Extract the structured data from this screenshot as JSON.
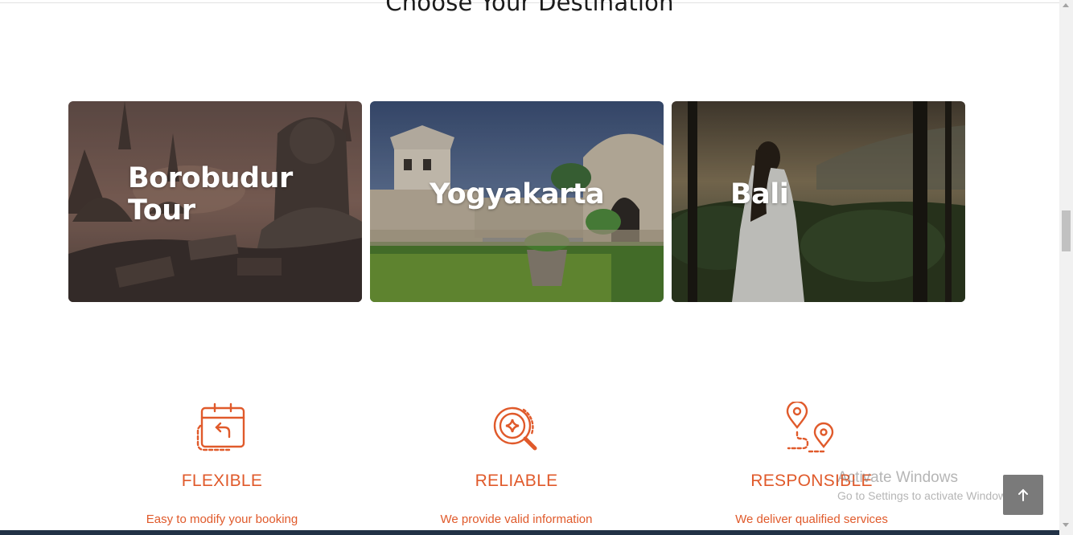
{
  "section": {
    "title": "Choose Your Destination"
  },
  "destinations": [
    {
      "label": "Borobudur Tour"
    },
    {
      "label": "Yogyakarta"
    },
    {
      "label": "Bali"
    }
  ],
  "features": [
    {
      "icon": "calendar-return-icon",
      "title": "FLEXIBLE",
      "description": "Easy to modify your booking"
    },
    {
      "icon": "search-sparkle-icon",
      "title": "RELIABLE",
      "description": "We provide valid information"
    },
    {
      "icon": "route-pins-icon",
      "title": "RESPONSIBLE",
      "description": "We deliver qualified services"
    }
  ],
  "watermark": {
    "line1": "Activate Windows",
    "line2": "Go to Settings to activate Windows."
  },
  "colors": {
    "accent": "#e05a2b",
    "back_to_top": "#7a7a7a",
    "footer": "#223246"
  }
}
